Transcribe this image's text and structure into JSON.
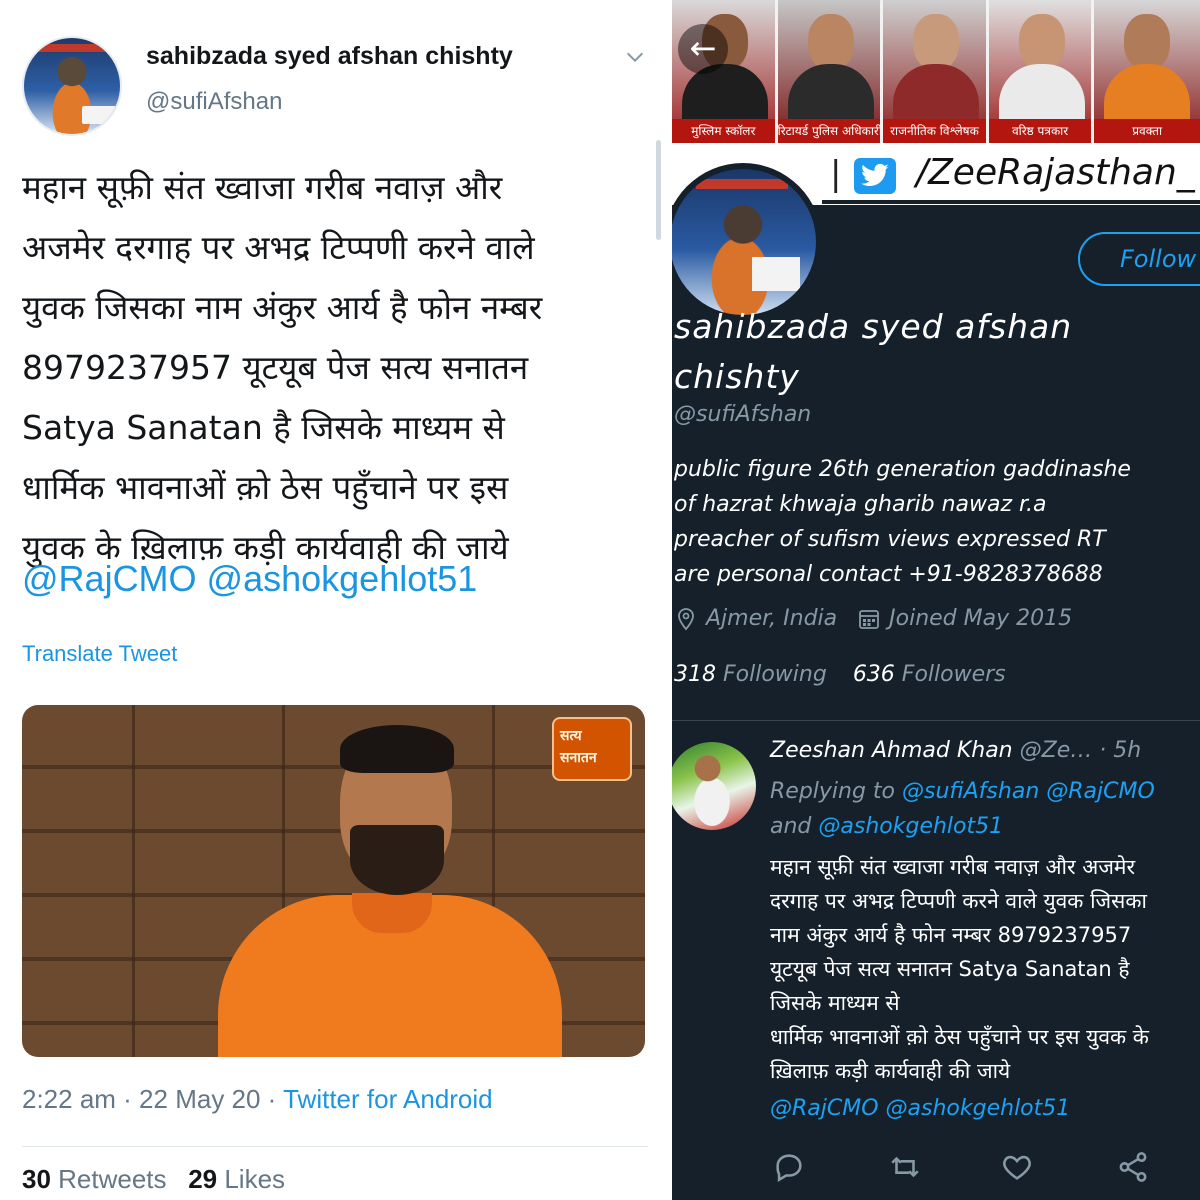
{
  "left_tweet": {
    "display_name": "sahibzada syed afshan chishty",
    "handle": "@sufiAfshan",
    "text_lines": [
      "महान सूफ़ी संत ख्वाजा गरीब नवाज़ और",
      "अजमेर दरगाह पर अभद्र टिप्पणी करने वाले",
      "युवक जिसका नाम अंकुर आर्य है फोन नम्बर",
      "8979237957 यूटयूब पेज सत्य सनातन",
      "Satya Sanatan है जिसके माध्यम से",
      "धार्मिक भावनाओं क़ो ठेस पहुँचाने पर इस",
      "युवक के ख़िलाफ़ कड़ी कार्यवाही की जाये"
    ],
    "mentions": "@RajCMO @ashokgehlot51",
    "translate_label": "Translate Tweet",
    "media_logo_line1": "सत्य",
    "media_logo_line2": "सनातन",
    "timestamp": "2:22 am · 22 May 20 · ",
    "source": "Twitter for Android",
    "retweets_count": "30",
    "retweets_label": " Retweets",
    "likes_count": "29",
    "likes_label": " Likes"
  },
  "profile": {
    "banner": {
      "captions": [
        "मुस्लिम स्कॉलर",
        "रिटायर्ड पुलिस अधिकारी",
        "राजनीतिक विश्लेषक",
        "वरिष्ठ पत्रकार",
        "प्रवक्ता"
      ],
      "handle_text": "/ZeeRajasthan_"
    },
    "follow_label": "Follow",
    "display_name": "sahibzada syed afshan chishty",
    "handle": "@sufiAfshan",
    "bio": "public figure 26th generation gaddinashe\nof hazrat khwaja gharib nawaz r.a\npreacher of sufism views expressed RT\nare personal contact +91-9828378688",
    "location": "Ajmer, India",
    "joined": "Joined May 2015",
    "following_count": "318",
    "following_label": " Following",
    "followers_count": "636",
    "followers_label": " Followers"
  },
  "reply": {
    "author": "Zeeshan Ahmad Khan",
    "handle_time": " @Ze… · 5h",
    "replying_prefix": "Replying to ",
    "replying_mentions": "@sufiAfshan @RajCMO",
    "and_word": "and ",
    "replying_mention_2": "@ashokgehlot51",
    "text_lines": [
      "महान सूफ़ी संत ख्वाजा गरीब नवाज़ और अजमेर",
      "दरगाह पर अभद्र टिप्पणी करने वाले युवक जिसका",
      "नाम अंकुर आर्य है फोन नम्बर 8979237957",
      "यूटयूब पेज सत्य सनातन Satya Sanatan है",
      "जिसके माध्यम से",
      "धार्मिक भावनाओं क़ो ठेस पहुँचाने पर इस युवक के",
      "ख़िलाफ़ कड़ी कार्यवाही की जाये"
    ],
    "mentions": "@RajCMO @ashokgehlot51"
  },
  "colors": {
    "link_blue": "#1b95e0",
    "dark_bg": "#15202b",
    "muted_gray": "#657786",
    "dark_muted": "#8899a6"
  },
  "icons": [
    "chevron-down-icon",
    "back-arrow-icon",
    "twitter-bird-icon",
    "location-pin-icon",
    "calendar-icon",
    "reply-icon",
    "retweet-icon",
    "like-icon",
    "share-icon"
  ]
}
